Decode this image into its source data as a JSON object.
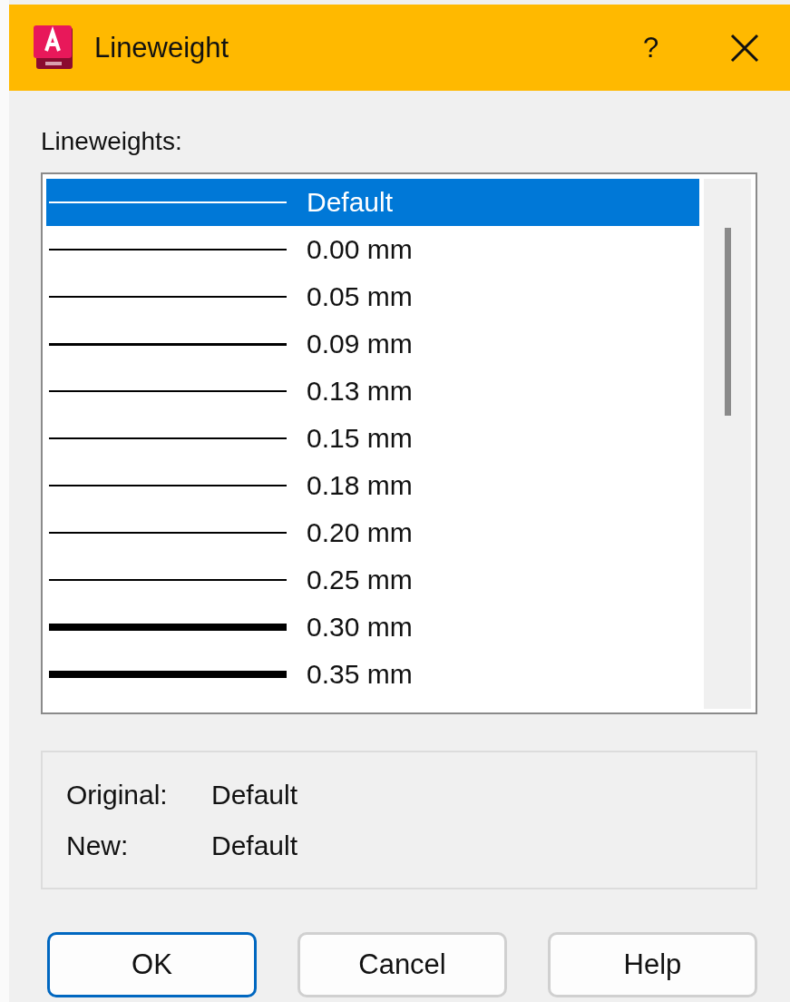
{
  "window": {
    "title": "Lineweight",
    "help": "?"
  },
  "list_label": "Lineweights:",
  "lineweights": [
    {
      "label": "Default",
      "kind": "thin",
      "selected": true
    },
    {
      "label": "0.00 mm",
      "kind": "thin",
      "selected": false
    },
    {
      "label": "0.05 mm",
      "kind": "thin",
      "selected": false
    },
    {
      "label": "0.09 mm",
      "kind": "medium",
      "selected": false
    },
    {
      "label": "0.13 mm",
      "kind": "thin",
      "selected": false
    },
    {
      "label": "0.15 mm",
      "kind": "thin",
      "selected": false
    },
    {
      "label": "0.18 mm",
      "kind": "thin",
      "selected": false
    },
    {
      "label": "0.20 mm",
      "kind": "thin",
      "selected": false
    },
    {
      "label": "0.25 mm",
      "kind": "thin",
      "selected": false
    },
    {
      "label": "0.30 mm",
      "kind": "thick",
      "selected": false
    },
    {
      "label": "0.35 mm",
      "kind": "thick",
      "selected": false
    }
  ],
  "info": [
    {
      "label": "Original:",
      "value": "Default"
    },
    {
      "label": "New:",
      "value": "Default"
    }
  ],
  "buttons": [
    {
      "label": "OK",
      "kind": "default"
    },
    {
      "label": "Cancel",
      "kind": "normal"
    },
    {
      "label": "Help",
      "kind": "normal"
    }
  ]
}
